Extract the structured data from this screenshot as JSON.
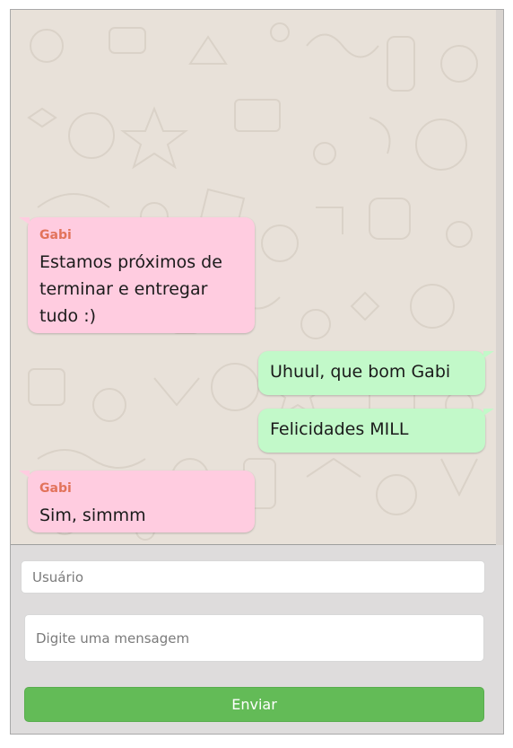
{
  "colors": {
    "incoming_bubble": "#ffcce0",
    "outgoing_bubble": "#c2f9c9",
    "author_name": "#e2735b",
    "chat_background": "#e8e1d9",
    "send_button": "#63bb57"
  },
  "messages": [
    {
      "direction": "incoming",
      "author": "Gabi",
      "text": "Estamos próximos de terminar e entregar tudo :)"
    },
    {
      "direction": "outgoing",
      "author": "",
      "text": "Uhuul, que bom Gabi"
    },
    {
      "direction": "outgoing",
      "author": "",
      "text": "Felicidades MILL"
    },
    {
      "direction": "incoming",
      "author": "Gabi",
      "text": "Sim, simmm"
    }
  ],
  "form": {
    "user_placeholder": "Usuário",
    "message_placeholder": "Digite uma mensagem",
    "send_label": "Enviar"
  }
}
